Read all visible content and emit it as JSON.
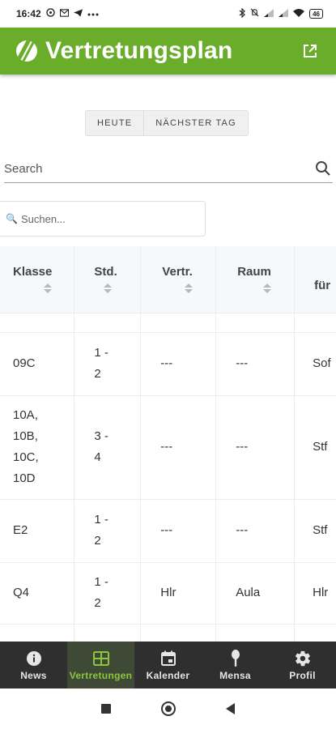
{
  "status_bar": {
    "time": "16:42",
    "battery": "46",
    "left_icons": [
      "whatsapp-icon",
      "mail-icon",
      "telegram-icon",
      "more-icon"
    ],
    "right_icons": [
      "bluetooth-icon",
      "mute-icon",
      "signal-icon",
      "signal-icon",
      "wifi-icon",
      "battery-icon"
    ]
  },
  "app_bar": {
    "title": "Vertretungsplan",
    "background": "#6aad2a"
  },
  "day_toggle": {
    "buttons": [
      "HEUTE",
      "NÄCHSTER TAG"
    ]
  },
  "search": {
    "label": "Search"
  },
  "filter": {
    "icon": "🔍",
    "placeholder": "Suchen..."
  },
  "table": {
    "headers": [
      "Klasse",
      "Std.",
      "Vertr.",
      "Raum",
      "für"
    ],
    "rows": [
      {
        "klasse": [
          "09C"
        ],
        "std": [
          "1 -",
          "2"
        ],
        "vertr": "---",
        "raum": "---",
        "fuer": "Sof"
      },
      {
        "klasse": [
          "10A,",
          "10B,",
          "10C,",
          "10D"
        ],
        "std": [
          "3 -",
          "4"
        ],
        "vertr": "---",
        "raum": "---",
        "fuer": "Stf"
      },
      {
        "klasse": [
          "E2"
        ],
        "std": [
          "1 -",
          "2"
        ],
        "vertr": "---",
        "raum": "---",
        "fuer": "Stf"
      },
      {
        "klasse": [
          "Q4"
        ],
        "std": [
          "1 -",
          "2"
        ],
        "vertr": "Hlr",
        "raum": "Aula",
        "fuer": "Hlr"
      }
    ]
  },
  "bottom_nav": {
    "items": [
      {
        "label": "News",
        "icon": "info-icon"
      },
      {
        "label": "Vertretungen",
        "icon": "table-icon"
      },
      {
        "label": "Kalender",
        "icon": "calendar-icon"
      },
      {
        "label": "Mensa",
        "icon": "food-icon"
      },
      {
        "label": "Profil",
        "icon": "gear-icon"
      }
    ],
    "active_accent": "#8cc63f"
  }
}
